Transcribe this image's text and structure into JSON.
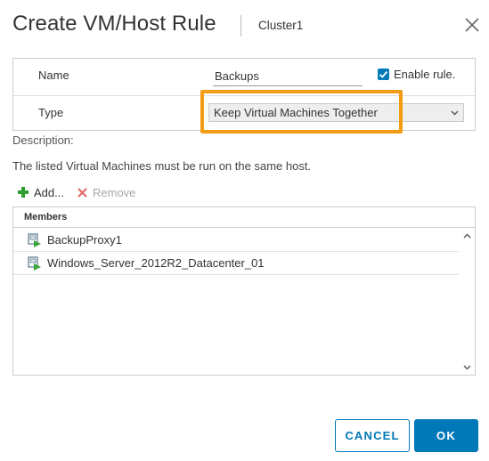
{
  "dialog": {
    "title": "Create VM/Host Rule",
    "cluster": "Cluster1",
    "close_icon": "close-icon"
  },
  "form": {
    "name_label": "Name",
    "name_value": "Backups",
    "enable_label": "Enable rule.",
    "enable_checked": true,
    "type_label": "Type",
    "type_value": "Keep Virtual Machines Together",
    "description_label": "Description:",
    "description_text": "The listed Virtual Machines must be run on the same host."
  },
  "toolbar": {
    "add_label": "Add...",
    "remove_label": "Remove",
    "add_icon": "plus-icon",
    "remove_icon": "x-icon"
  },
  "members": {
    "header": "Members",
    "items": [
      {
        "name": "BackupProxy1",
        "icon": "vm-icon"
      },
      {
        "name": "Windows_Server_2012R2_Datacenter_01",
        "icon": "vm-icon"
      }
    ]
  },
  "footer": {
    "cancel_label": "CANCEL",
    "ok_label": "OK"
  },
  "colors": {
    "accent": "#0079b8",
    "highlight": "#f39c12",
    "add_green": "#2e9e2e",
    "remove_red": "#e06b6b"
  }
}
